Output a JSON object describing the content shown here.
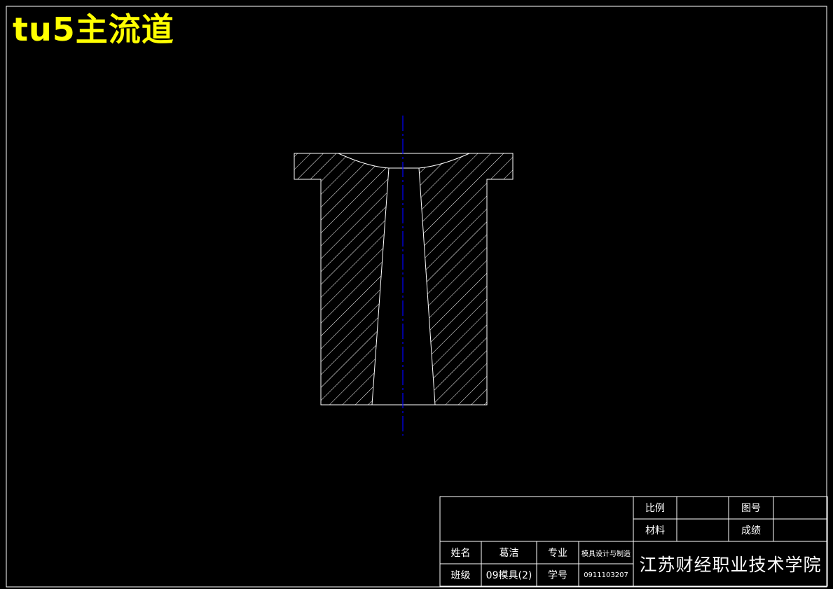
{
  "drawing": {
    "title": "tu5主流道",
    "colors": {
      "background": "#000000",
      "lines": "#ffffff",
      "title": "#ffff00",
      "centerline": "#0000ff"
    }
  },
  "title_block": {
    "scale_label": "比例",
    "scale_value": "",
    "drawing_no_label": "图号",
    "drawing_no_value": "",
    "material_label": "材料",
    "material_value": "",
    "grade_label": "成绩",
    "grade_value": "",
    "name_label": "姓名",
    "name_value": "葛洁",
    "major_label": "专业",
    "major_value": "模具设计与制造",
    "class_label": "班级",
    "class_value": "09模具(2)",
    "student_id_label": "学号",
    "student_id_value": "0911103207",
    "school": "江苏财经职业技术学院"
  }
}
